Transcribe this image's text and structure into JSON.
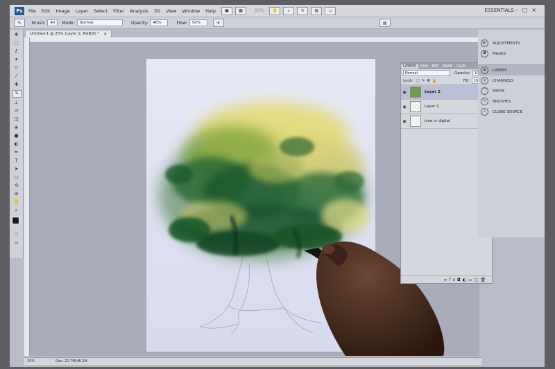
{
  "app": {
    "logo": "Ps",
    "menu": [
      "File",
      "Edit",
      "Image",
      "Layer",
      "Select",
      "Filter",
      "Analysis",
      "3D",
      "View",
      "Window",
      "Help"
    ],
    "zoom_display": "25%",
    "workspace": "ESSENTIALS",
    "window_controls": "–□×"
  },
  "options_bar": {
    "brush_label": "Brush:",
    "brush_size": "40",
    "mode_label": "Mode:",
    "mode_value": "Normal",
    "opacity_label": "Opacity:",
    "opacity_value": "46%",
    "flow_label": "Flow:",
    "flow_value": "50%"
  },
  "document": {
    "tab_title": "Untitled-1 @ 25% (Layer 2, RGB/8) *",
    "close": "×"
  },
  "status_bar": {
    "zoom": "25%",
    "doc_info": "Doc: 22.7M/48.2M"
  },
  "layers_panel": {
    "tabs": [
      "LAYERS",
      "CHA",
      "PATI",
      "BRSE",
      "CLON"
    ],
    "blend_mode": "Normal",
    "opacity_label": "Opacity:",
    "opacity_value": "100%",
    "lock_label": "Lock:",
    "fill_label": "Fill:",
    "fill_value": "100%",
    "layers": [
      {
        "name": "Layer 2",
        "selected": true
      },
      {
        "name": "Layer 1",
        "selected": false
      },
      {
        "name": "tree in digital",
        "selected": false
      }
    ]
  },
  "right_dock": {
    "items": [
      {
        "label": "ADJUSTMENTS",
        "icon": "adjustments-icon"
      },
      {
        "label": "MASKS",
        "icon": "masks-icon"
      },
      {
        "label": "LAYERS",
        "icon": "layers-icon",
        "active": true
      },
      {
        "label": "CHANNELS",
        "icon": "channels-icon"
      },
      {
        "label": "PATHS",
        "icon": "paths-icon"
      },
      {
        "label": "BRUSHES",
        "icon": "brushes-icon"
      },
      {
        "label": "CLONE SOURCE",
        "icon": "clone-source-icon"
      }
    ]
  },
  "colors": {
    "ui_gray": "#cfd1d8",
    "canvas_bg": "#a9adbb",
    "foliage_dark": "#1f5a2a",
    "foliage_light": "#e8e07a"
  }
}
